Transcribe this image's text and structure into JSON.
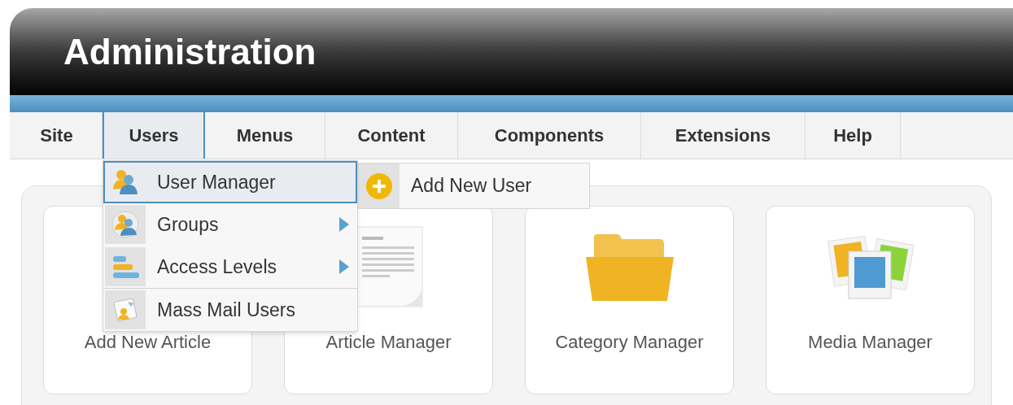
{
  "header": {
    "title": "Administration"
  },
  "menu": [
    {
      "label": "Site",
      "selected": false
    },
    {
      "label": "Users",
      "selected": true
    },
    {
      "label": "Menus",
      "selected": false
    },
    {
      "label": "Content",
      "selected": false
    },
    {
      "label": "Components",
      "selected": false
    },
    {
      "label": "Extensions",
      "selected": false
    },
    {
      "label": "Help",
      "selected": false
    }
  ],
  "dropdown": {
    "items": [
      {
        "label": "User Manager",
        "selected": true,
        "has_submenu": false,
        "separator_before": false
      },
      {
        "label": "Groups",
        "selected": false,
        "has_submenu": true,
        "separator_before": false
      },
      {
        "label": "Access Levels",
        "selected": false,
        "has_submenu": true,
        "separator_before": false
      },
      {
        "label": "Mass Mail Users",
        "selected": false,
        "has_submenu": false,
        "separator_before": true
      }
    ]
  },
  "submenu": {
    "items": [
      {
        "label": "Add New User"
      }
    ]
  },
  "cards": [
    {
      "label": "Add New Article"
    },
    {
      "label": "Article Manager"
    },
    {
      "label": "Category Manager"
    },
    {
      "label": "Media Manager"
    }
  ]
}
